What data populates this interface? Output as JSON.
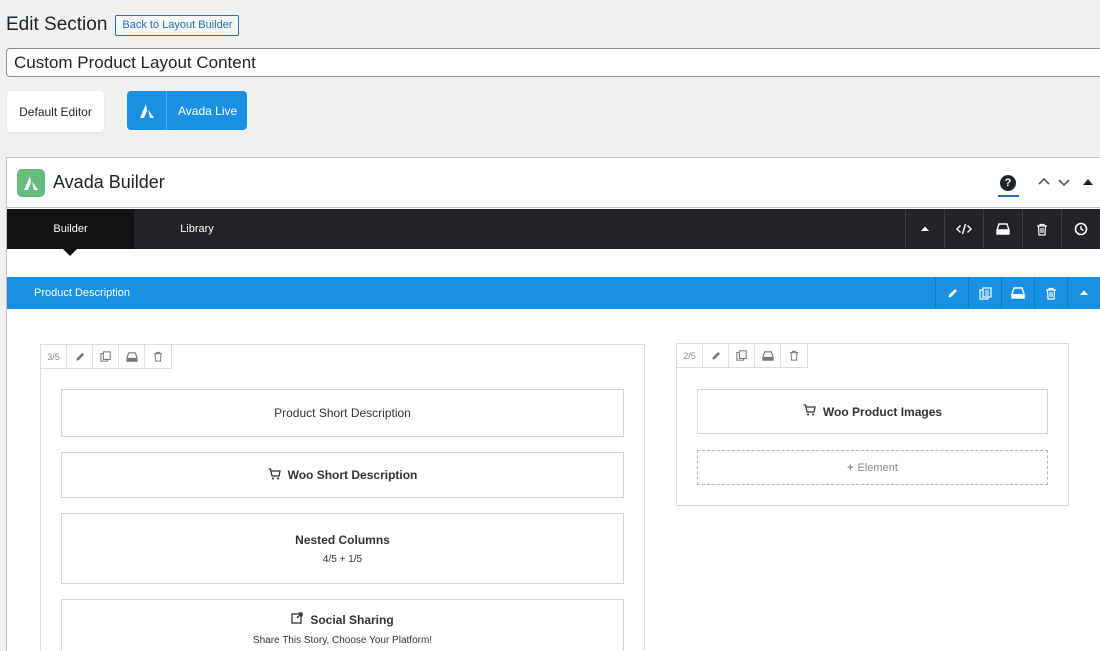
{
  "header": {
    "page_title": "Edit Section",
    "back_button": "Back to Layout Builder",
    "title_value": "Custom Product Layout Content"
  },
  "editor_buttons": {
    "default_editor": "Default Editor",
    "avada_live": "Avada Live"
  },
  "builder": {
    "title": "Avada Builder",
    "help_label": "?",
    "tabs": [
      {
        "label": "Builder",
        "active": true
      },
      {
        "label": "Library",
        "active": false
      }
    ],
    "toolbar_icons": [
      "collapse-icon",
      "code-icon",
      "save-icon",
      "trash-icon",
      "history-icon"
    ]
  },
  "section": {
    "label": "Product Description",
    "tool_icons": [
      "pencil-icon",
      "clone-icon",
      "save-icon",
      "trash-icon",
      "collapse-icon"
    ]
  },
  "columns": [
    {
      "size": "3/5",
      "elements": [
        {
          "title": "Product Short Description",
          "bold": false
        },
        {
          "title": "Woo Short Description",
          "bold": true,
          "icon": "cart-icon"
        },
        {
          "title": "Nested Columns",
          "bold": true,
          "subtitle": "4/5 + 1/5"
        },
        {
          "title": "Social Sharing",
          "bold": true,
          "icon": "share-icon",
          "subtitle": "Share This Story, Choose Your Platform!"
        }
      ]
    },
    {
      "size": "2/5",
      "elements": [
        {
          "title": "Woo Product Images",
          "bold": true,
          "icon": "cart-icon"
        }
      ],
      "add_element_label": "Element"
    }
  ],
  "colors": {
    "accent_blue": "#1a90e2",
    "dark_bar": "#222326",
    "avada_green": "#65bc7b"
  }
}
